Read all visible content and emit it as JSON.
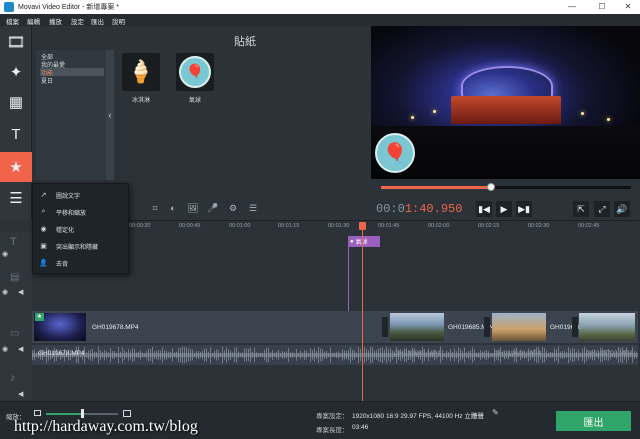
{
  "window": {
    "title": "Movavi Video Editor - 新增專案 *",
    "minimize": "—",
    "maximize": "☐",
    "close": "✕"
  },
  "menu": [
    "檔案",
    "編輯",
    "播放",
    "設定",
    "匯出",
    "說明"
  ],
  "left_tools": [
    {
      "name": "import-icon",
      "glyph": "🎞"
    },
    {
      "name": "filters-icon",
      "glyph": "✦"
    },
    {
      "name": "transitions-icon",
      "glyph": "▦"
    },
    {
      "name": "titles-icon",
      "glyph": "T"
    },
    {
      "name": "stickers-icon",
      "glyph": "★"
    },
    {
      "name": "more-icon",
      "glyph": "☰"
    }
  ],
  "stickers_panel": {
    "title": "貼紙",
    "categories": [
      "全部",
      "我的最愛",
      "功能",
      "夏日"
    ],
    "selected_category": "功能",
    "items": [
      {
        "label": "冰淇淋",
        "glyph": "🍦"
      },
      {
        "label": "氣球",
        "glyph": "🎈"
      }
    ]
  },
  "more_menu": [
    {
      "label": "圖說文字",
      "glyph": "↗"
    },
    {
      "label": "平移和縮放",
      "glyph": "⌕"
    },
    {
      "label": "穩定化",
      "glyph": "◉"
    },
    {
      "label": "突出顯示和隱藏",
      "glyph": "▣"
    },
    {
      "label": "去背",
      "glyph": "👤"
    }
  ],
  "player": {
    "timecode_prefix": "00:0",
    "timecode_main": "1:40.950",
    "progress": 0.44,
    "prev_icon": "▮◀",
    "play_icon": "▶",
    "next_icon": "▶▮",
    "export_frame_icon": "⇱",
    "fullscreen_icon": "⤢",
    "volume_icon": "🔊"
  },
  "edit_tools": [
    "↶",
    "↷",
    "🗑",
    "✂",
    "↻",
    "⌗",
    "◐",
    "🖼",
    "🎤",
    "⚙",
    "☰"
  ],
  "ruler": [
    "00:00:30",
    "00:00:45",
    "00:01:00",
    "00:01:15",
    "00:01:30",
    "00:01:45",
    "00:02:00",
    "00:02:15",
    "00:02:30",
    "00:02:45"
  ],
  "timeline": {
    "sticker_clip": "氣球",
    "video_clips": [
      "GH019678.MP4",
      "GH019685.MP4",
      "GH019688.MP4",
      "GH0197"
    ],
    "audio_clips": [
      "GH019678.MP4",
      "GH019685.MP4",
      "GH019688.MP4",
      "GH019700.MP4"
    ]
  },
  "bottom": {
    "zoom_label": "縮放：",
    "project_settings_label": "專案設定：",
    "project_settings_value": "1920x1080 16:9 29.97 FPS, 44100 Hz 立體聲",
    "project_length_label": "專案長度：",
    "project_length_value": "03:46",
    "export_label": "匯出",
    "zoom_level": 0.5
  },
  "watermark": "http://hardaway.com.tw/blog"
}
